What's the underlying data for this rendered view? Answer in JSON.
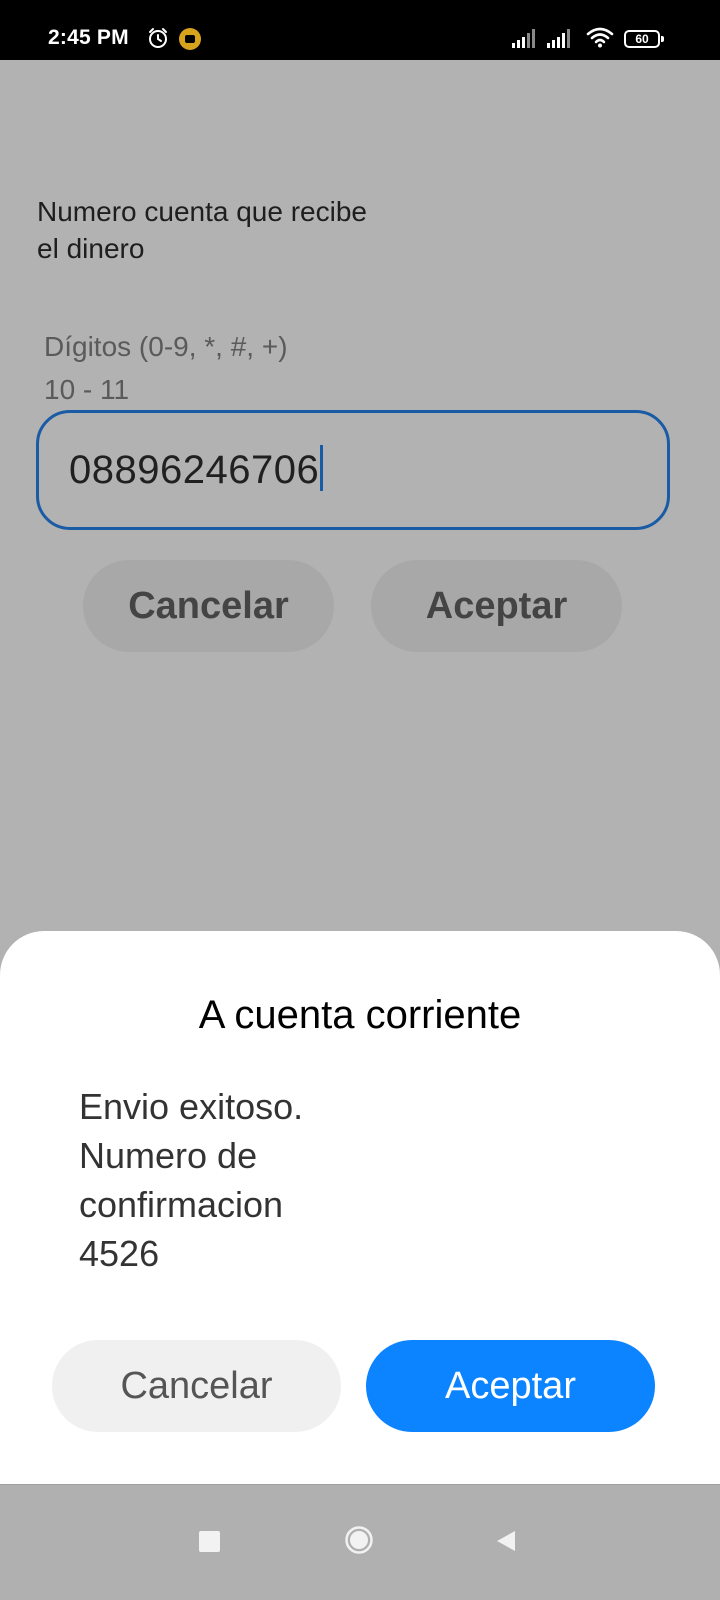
{
  "status_bar": {
    "time": "2:45 PM",
    "battery": "60"
  },
  "background_form": {
    "field_label": "Numero cuenta que recibe el dinero",
    "hint_line1": "Dígitos (0-9, *, #, +)",
    "hint_line2": "10 - 11",
    "account_value": "08896246706",
    "cancel_label": "Cancelar",
    "accept_label": "Aceptar"
  },
  "dialog": {
    "title": "A cuenta corriente",
    "message_line1": "Envio exitoso.",
    "message_line2": "Numero de",
    "message_line3": "confirmacion",
    "message_line4": "4526",
    "cancel_label": "Cancelar",
    "accept_label": "Aceptar",
    "accent_color": "#0d84ff"
  },
  "navigation": {
    "icons": [
      "recents-icon",
      "home-icon",
      "back-icon"
    ]
  }
}
